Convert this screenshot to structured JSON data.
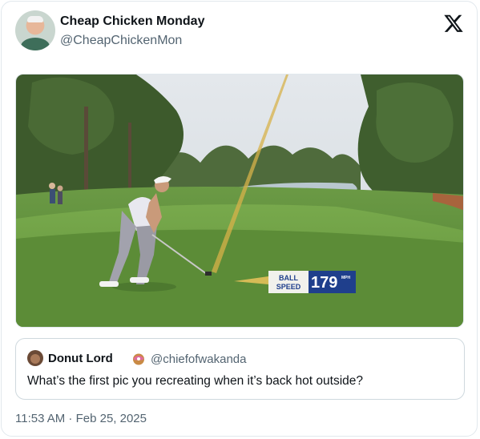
{
  "tweet": {
    "author": {
      "display_name": "Cheap Chicken Monday",
      "handle": "@CheapChickenMon",
      "avatar": "profile-photo"
    },
    "platform_icon": "x-logo-icon",
    "media": {
      "overlay": {
        "ball_label_line1": "BALL",
        "ball_label_line2": "SPEED",
        "speed_value": "179",
        "speed_unit": "MPH"
      },
      "colors": {
        "overlay_blue": "#1f3f8c",
        "tracer": "#d7b24a",
        "grass": "#5f8f3c"
      }
    },
    "quoted_tweet": {
      "display_name": "Donut Lord",
      "emoji": "donut-icon",
      "handle": "@chiefofwakanda",
      "text": "What’s the first pic you recreating when it’s back hot outside?"
    },
    "timestamp": "11:53 AM · Feb 25, 2025"
  }
}
